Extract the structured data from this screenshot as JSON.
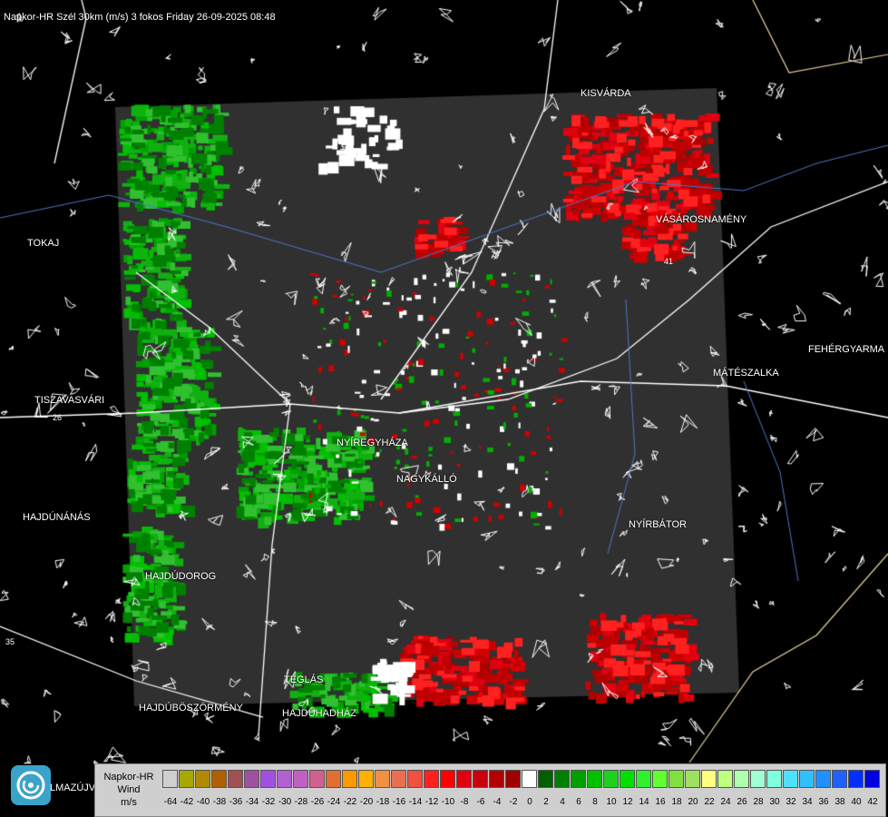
{
  "header": {
    "title": "Napkor-HR Szél 30km (m/s) 3 fokos Friday 26-09-2025 08:48"
  },
  "places": [
    {
      "id": "kisvarda",
      "name": "KISVÁRDA"
    },
    {
      "id": "vasarosnameny",
      "name": "VÁSÁROSNAMÉNY"
    },
    {
      "id": "tokaj",
      "name": "TOKAJ"
    },
    {
      "id": "fehergyarmat",
      "name": "FEHÉRGYARMA"
    },
    {
      "id": "mateszalka",
      "name": "MÁTÉSZALKA"
    },
    {
      "id": "tiszavasvari",
      "name": "TISZAVASVÁRI"
    },
    {
      "id": "nyiregyhaza",
      "name": "NYÍREGYHÁZA"
    },
    {
      "id": "nagykallo",
      "name": "NAGYKÁLLÓ"
    },
    {
      "id": "hajdunanas",
      "name": "HAJDÚNÁNÁS"
    },
    {
      "id": "nyirbator",
      "name": "NYÍRBÁTOR"
    },
    {
      "id": "hajdudorog",
      "name": "HAJDÚDOROG"
    },
    {
      "id": "teglas",
      "name": "TÉGLÁS"
    },
    {
      "id": "hajduboszormeny",
      "name": "HAJDÚBÖSZÖRMÉNY"
    },
    {
      "id": "hajduhadhaz",
      "name": "HAJDÚHADHÁZ"
    },
    {
      "id": "balmazujvaros",
      "name": "LMAZÚJVÁR"
    }
  ],
  "roads": [
    {
      "id": "r26",
      "label": "26"
    },
    {
      "id": "r35",
      "label": "35"
    },
    {
      "id": "r41",
      "label": "41"
    }
  ],
  "legend": {
    "product_line1": "Napkor-HR",
    "product_line2": "Wind",
    "unit": "m/s",
    "ticks": [
      "-64",
      "-42",
      "-40",
      "-38",
      "-36",
      "-34",
      "-32",
      "-30",
      "-28",
      "-26",
      "-24",
      "-22",
      "-20",
      "-18",
      "-16",
      "-14",
      "-12",
      "-10",
      "-8",
      "-6",
      "-4",
      "-2",
      "0",
      "2",
      "4",
      "6",
      "8",
      "10",
      "12",
      "14",
      "16",
      "18",
      "20",
      "22",
      "24",
      "26",
      "28",
      "30",
      "32",
      "34",
      "36",
      "38",
      "40",
      "42"
    ],
    "colors": [
      "#cfcfcf",
      "#a8a800",
      "#b08a00",
      "#b06000",
      "#a05050",
      "#a050a0",
      "#a050e0",
      "#b060d0",
      "#c060c0",
      "#d06090",
      "#e07030",
      "#ff9900",
      "#ffb000",
      "#f09040",
      "#e87050",
      "#f05040",
      "#ff2020",
      "#ff0000",
      "#e00010",
      "#c80010",
      "#b00000",
      "#a00000",
      "#ffffff",
      "#006000",
      "#008000",
      "#00a000",
      "#00c000",
      "#20d020",
      "#00e000",
      "#30f030",
      "#60ff30",
      "#80e040",
      "#a0e060",
      "#ffff80",
      "#c0ff80",
      "#b0ffb0",
      "#a0ffd0",
      "#80ffe0",
      "#50e0ff",
      "#30c0ff",
      "#2090ff",
      "#2060ff",
      "#0030ff",
      "#0000e0"
    ]
  },
  "colors": {
    "scan_background": "#303030",
    "approaching": "#00b000",
    "receding": "#d00000"
  }
}
